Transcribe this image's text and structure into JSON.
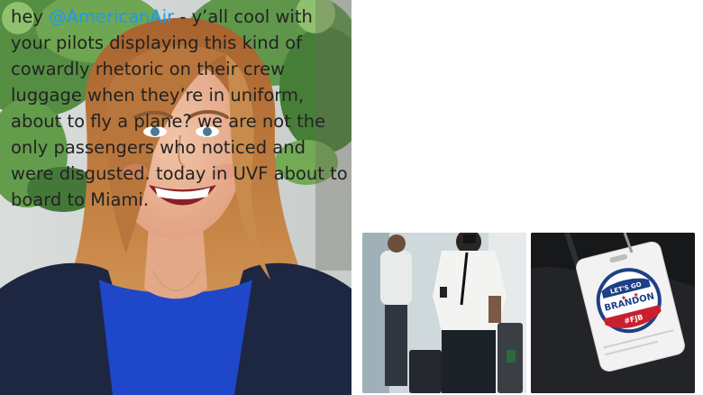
{
  "tweet": {
    "lines": [
      {
        "prefix": "hey ",
        "mention": "@AmericanAir",
        "suffix": " - y’all cool with"
      },
      {
        "text": "your pilots displaying this kind of"
      },
      {
        "text": "cowardly rhetoric on their crew"
      },
      {
        "text": "luggage when they’re in uniform,"
      },
      {
        "text": "about to fly a plane? we are not the"
      },
      {
        "text": "only passengers who noticed and"
      },
      {
        "text": "were disgusted. today in UVF about to"
      },
      {
        "text": "board to Miami."
      }
    ]
  },
  "luggage_tag": {
    "line1": "LET'S GO",
    "line2": "BRANDON",
    "number": "#FJB"
  },
  "colors": {
    "mention": "#1d9bf0",
    "text": "#222222"
  }
}
